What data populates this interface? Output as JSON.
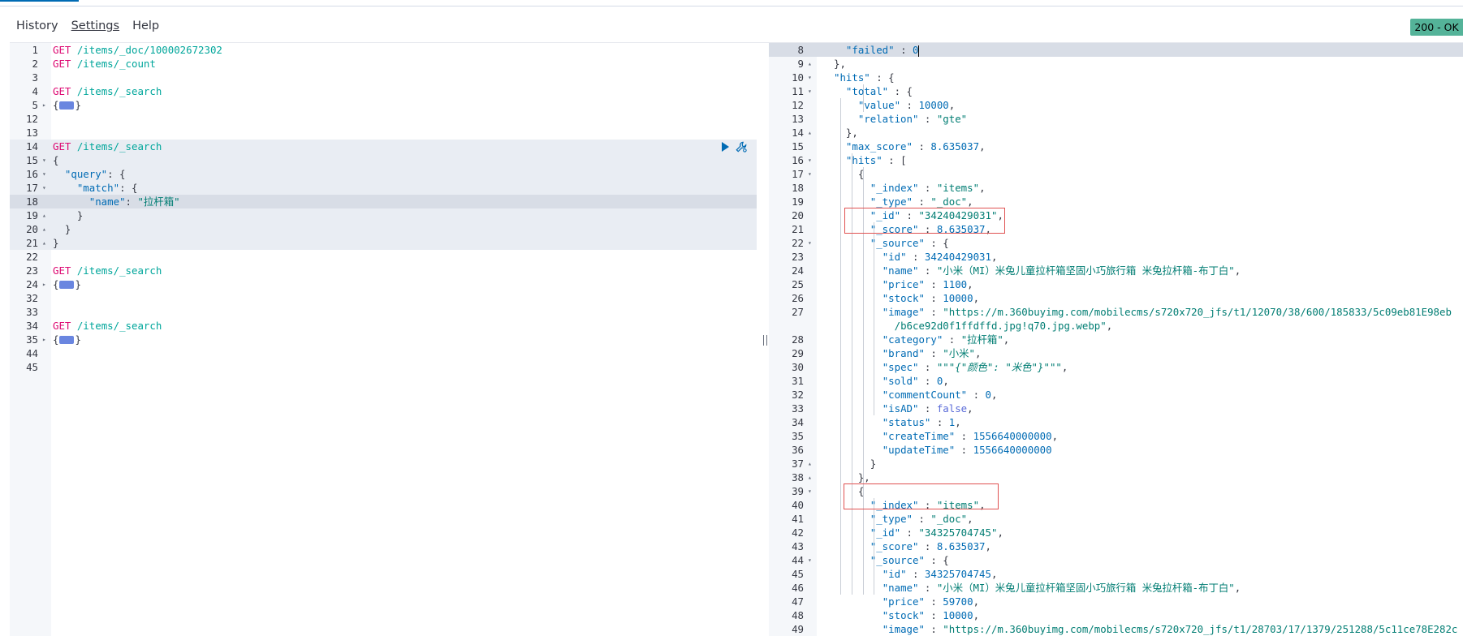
{
  "menu": {
    "history": "History",
    "settings": "Settings",
    "help": "Help"
  },
  "status": {
    "label": "200 - OK",
    "color": "#54b399"
  },
  "icons": {
    "run": "play-icon",
    "settings": "wrench-icon",
    "divider": "resize-handle-icon"
  },
  "request_editor": {
    "lines": [
      {
        "n": "1",
        "fold": "",
        "tokens": [
          [
            "method",
            "GET"
          ],
          [
            "path",
            " /items/_doc/100002672302"
          ]
        ]
      },
      {
        "n": "2",
        "fold": "",
        "tokens": [
          [
            "method",
            "GET"
          ],
          [
            "path",
            " /items/_count"
          ]
        ]
      },
      {
        "n": "3",
        "fold": "",
        "tokens": []
      },
      {
        "n": "4",
        "fold": "",
        "tokens": [
          [
            "method",
            "GET"
          ],
          [
            "path",
            " /items/_search"
          ]
        ]
      },
      {
        "n": "5",
        "fold": "▸",
        "tokens": [
          [
            "p",
            "{"
          ],
          [
            "tag",
            ""
          ],
          [
            "p",
            "}"
          ]
        ]
      },
      {
        "n": "12",
        "fold": "",
        "tokens": []
      },
      {
        "n": "13",
        "fold": "",
        "tokens": []
      },
      {
        "n": "14",
        "fold": "",
        "hl": "block",
        "actions": true,
        "tokens": [
          [
            "method",
            "GET"
          ],
          [
            "path",
            " /items/_search"
          ]
        ]
      },
      {
        "n": "15",
        "fold": "▾",
        "hl": "block",
        "tokens": [
          [
            "p",
            "{"
          ]
        ]
      },
      {
        "n": "16",
        "fold": "▾",
        "hl": "block",
        "tokens": [
          [
            "p",
            "  "
          ],
          [
            "k",
            "\"query\""
          ],
          [
            "p",
            ": {"
          ]
        ]
      },
      {
        "n": "17",
        "fold": "▾",
        "hl": "block",
        "tokens": [
          [
            "p",
            "    "
          ],
          [
            "k",
            "\"match\""
          ],
          [
            "p",
            ": {"
          ]
        ]
      },
      {
        "n": "18",
        "fold": "",
        "hl": "line",
        "tokens": [
          [
            "p",
            "      "
          ],
          [
            "k",
            "\"name\""
          ],
          [
            "p",
            ": "
          ],
          [
            "s",
            "\"拉杆箱\""
          ]
        ]
      },
      {
        "n": "19",
        "fold": "▴",
        "hl": "block",
        "tokens": [
          [
            "p",
            "    }"
          ]
        ]
      },
      {
        "n": "20",
        "fold": "▴",
        "hl": "block",
        "tokens": [
          [
            "p",
            "  }"
          ]
        ]
      },
      {
        "n": "21",
        "fold": "▴",
        "hl": "block",
        "tokens": [
          [
            "p",
            "}"
          ]
        ]
      },
      {
        "n": "22",
        "fold": "",
        "tokens": []
      },
      {
        "n": "23",
        "fold": "",
        "tokens": [
          [
            "method",
            "GET"
          ],
          [
            "path",
            " /items/_search"
          ]
        ]
      },
      {
        "n": "24",
        "fold": "▸",
        "tokens": [
          [
            "p",
            "{"
          ],
          [
            "tag",
            ""
          ],
          [
            "p",
            "}"
          ]
        ]
      },
      {
        "n": "32",
        "fold": "",
        "tokens": []
      },
      {
        "n": "33",
        "fold": "",
        "tokens": []
      },
      {
        "n": "34",
        "fold": "",
        "tokens": [
          [
            "method",
            "GET"
          ],
          [
            "path",
            " /items/_search"
          ]
        ]
      },
      {
        "n": "35",
        "fold": "▸",
        "tokens": [
          [
            "p",
            "{"
          ],
          [
            "tag",
            ""
          ],
          [
            "p",
            "}"
          ]
        ]
      },
      {
        "n": "44",
        "fold": "",
        "tokens": []
      },
      {
        "n": "45",
        "fold": "",
        "tokens": []
      }
    ]
  },
  "response_editor": {
    "lines": [
      {
        "n": "8",
        "fold": "",
        "hl": "line",
        "cursor": true,
        "tokens": [
          [
            "p",
            "  "
          ],
          [
            "k",
            "\"failed\""
          ],
          [
            "p",
            " : "
          ],
          [
            "n",
            "0"
          ]
        ]
      },
      {
        "n": "9",
        "fold": "▴",
        "tokens": [
          [
            "p",
            "},"
          ]
        ]
      },
      {
        "n": "10",
        "fold": "▾",
        "tokens": [
          [
            "k",
            "\"hits\""
          ],
          [
            "p",
            " : {"
          ]
        ]
      },
      {
        "n": "11",
        "fold": "▾",
        "tokens": [
          [
            "p",
            "  "
          ],
          [
            "k",
            "\"total\""
          ],
          [
            "p",
            " : {"
          ]
        ]
      },
      {
        "n": "12",
        "fold": "",
        "tokens": [
          [
            "p",
            "    "
          ],
          [
            "k",
            "\"value\""
          ],
          [
            "p",
            " : "
          ],
          [
            "n",
            "10000"
          ],
          [
            "p",
            ","
          ]
        ]
      },
      {
        "n": "13",
        "fold": "",
        "tokens": [
          [
            "p",
            "    "
          ],
          [
            "k",
            "\"relation\""
          ],
          [
            "p",
            " : "
          ],
          [
            "s",
            "\"gte\""
          ]
        ]
      },
      {
        "n": "14",
        "fold": "▴",
        "tokens": [
          [
            "p",
            "  },"
          ]
        ]
      },
      {
        "n": "15",
        "fold": "",
        "tokens": [
          [
            "p",
            "  "
          ],
          [
            "k",
            "\"max_score\""
          ],
          [
            "p",
            " : "
          ],
          [
            "n",
            "8.635037"
          ],
          [
            "p",
            ","
          ]
        ]
      },
      {
        "n": "16",
        "fold": "▾",
        "tokens": [
          [
            "p",
            "  "
          ],
          [
            "k",
            "\"hits\""
          ],
          [
            "p",
            " : ["
          ]
        ]
      },
      {
        "n": "17",
        "fold": "▾",
        "tokens": [
          [
            "p",
            "    {"
          ]
        ]
      },
      {
        "n": "18",
        "fold": "",
        "tokens": [
          [
            "p",
            "      "
          ],
          [
            "k",
            "\"_index\""
          ],
          [
            "p",
            " : "
          ],
          [
            "s",
            "\"items\""
          ],
          [
            "p",
            ","
          ]
        ]
      },
      {
        "n": "19",
        "fold": "",
        "tokens": [
          [
            "p",
            "      "
          ],
          [
            "k",
            "\"_type\""
          ],
          [
            "p",
            " : "
          ],
          [
            "s",
            "\"_doc\""
          ],
          [
            "p",
            ","
          ]
        ]
      },
      {
        "n": "20",
        "fold": "",
        "tokens": [
          [
            "p",
            "      "
          ],
          [
            "k",
            "\"_id\""
          ],
          [
            "p",
            " : "
          ],
          [
            "s",
            "\"34240429031\""
          ],
          [
            "p",
            ","
          ]
        ]
      },
      {
        "n": "21",
        "fold": "",
        "tokens": [
          [
            "p",
            "      "
          ],
          [
            "k",
            "\"_score\""
          ],
          [
            "p",
            " : "
          ],
          [
            "n",
            "8.635037"
          ],
          [
            "p",
            ","
          ]
        ]
      },
      {
        "n": "22",
        "fold": "▾",
        "tokens": [
          [
            "p",
            "      "
          ],
          [
            "k",
            "\"_source\""
          ],
          [
            "p",
            " : {"
          ]
        ]
      },
      {
        "n": "23",
        "fold": "",
        "tokens": [
          [
            "p",
            "        "
          ],
          [
            "k",
            "\"id\""
          ],
          [
            "p",
            " : "
          ],
          [
            "n",
            "34240429031"
          ],
          [
            "p",
            ","
          ]
        ]
      },
      {
        "n": "24",
        "fold": "",
        "tokens": [
          [
            "p",
            "        "
          ],
          [
            "k",
            "\"name\""
          ],
          [
            "p",
            " : "
          ],
          [
            "s",
            "\"小米（MI）米兔儿童拉杆箱坚固小巧旅行箱 米兔拉杆箱-布丁白\""
          ],
          [
            "p",
            ","
          ]
        ]
      },
      {
        "n": "25",
        "fold": "",
        "tokens": [
          [
            "p",
            "        "
          ],
          [
            "k",
            "\"price\""
          ],
          [
            "p",
            " : "
          ],
          [
            "n",
            "1100"
          ],
          [
            "p",
            ","
          ]
        ]
      },
      {
        "n": "26",
        "fold": "",
        "tokens": [
          [
            "p",
            "        "
          ],
          [
            "k",
            "\"stock\""
          ],
          [
            "p",
            " : "
          ],
          [
            "n",
            "10000"
          ],
          [
            "p",
            ","
          ]
        ]
      },
      {
        "n": "27",
        "fold": "",
        "tokens": [
          [
            "p",
            "        "
          ],
          [
            "k",
            "\"image\""
          ],
          [
            "p",
            " : "
          ],
          [
            "s",
            "\"https://m.360buyimg.com/mobilecms/s720x720_jfs/t1/12070/38/600/185833/5c09eb81E98eb"
          ]
        ]
      },
      {
        "n": "",
        "fold": "",
        "tokens": [
          [
            "p",
            "          "
          ],
          [
            "s",
            "/b6ce92d0f1ffdffd.jpg!q70.jpg.webp\""
          ],
          [
            "p",
            ","
          ]
        ]
      },
      {
        "n": "28",
        "fold": "",
        "tokens": [
          [
            "p",
            "        "
          ],
          [
            "k",
            "\"category\""
          ],
          [
            "p",
            " : "
          ],
          [
            "s",
            "\"拉杆箱\""
          ],
          [
            "p",
            ","
          ]
        ]
      },
      {
        "n": "29",
        "fold": "",
        "tokens": [
          [
            "p",
            "        "
          ],
          [
            "k",
            "\"brand\""
          ],
          [
            "p",
            " : "
          ],
          [
            "s",
            "\"小米\""
          ],
          [
            "p",
            ","
          ]
        ]
      },
      {
        "n": "30",
        "fold": "",
        "tokens": [
          [
            "p",
            "        "
          ],
          [
            "k",
            "\"spec\""
          ],
          [
            "p",
            " : "
          ],
          [
            "s",
            "\"\"\""
          ],
          [
            "i",
            "{\"颜色\": \"米色\"}"
          ],
          [
            "s",
            "\"\"\""
          ],
          [
            "p",
            ","
          ]
        ]
      },
      {
        "n": "31",
        "fold": "",
        "tokens": [
          [
            "p",
            "        "
          ],
          [
            "k",
            "\"sold\""
          ],
          [
            "p",
            " : "
          ],
          [
            "n",
            "0"
          ],
          [
            "p",
            ","
          ]
        ]
      },
      {
        "n": "32",
        "fold": "",
        "tokens": [
          [
            "p",
            "        "
          ],
          [
            "k",
            "\"commentCount\""
          ],
          [
            "p",
            " : "
          ],
          [
            "n",
            "0"
          ],
          [
            "p",
            ","
          ]
        ]
      },
      {
        "n": "33",
        "fold": "",
        "tokens": [
          [
            "p",
            "        "
          ],
          [
            "k",
            "\"isAD\""
          ],
          [
            "p",
            " : "
          ],
          [
            "b",
            "false"
          ],
          [
            "p",
            ","
          ]
        ]
      },
      {
        "n": "34",
        "fold": "",
        "tokens": [
          [
            "p",
            "        "
          ],
          [
            "k",
            "\"status\""
          ],
          [
            "p",
            " : "
          ],
          [
            "n",
            "1"
          ],
          [
            "p",
            ","
          ]
        ]
      },
      {
        "n": "35",
        "fold": "",
        "tokens": [
          [
            "p",
            "        "
          ],
          [
            "k",
            "\"createTime\""
          ],
          [
            "p",
            " : "
          ],
          [
            "n",
            "1556640000000"
          ],
          [
            "p",
            ","
          ]
        ]
      },
      {
        "n": "36",
        "fold": "",
        "tokens": [
          [
            "p",
            "        "
          ],
          [
            "k",
            "\"updateTime\""
          ],
          [
            "p",
            " : "
          ],
          [
            "n",
            "1556640000000"
          ]
        ]
      },
      {
        "n": "37",
        "fold": "▴",
        "tokens": [
          [
            "p",
            "      }"
          ]
        ]
      },
      {
        "n": "38",
        "fold": "▴",
        "tokens": [
          [
            "p",
            "    },"
          ]
        ]
      },
      {
        "n": "39",
        "fold": "▾",
        "tokens": [
          [
            "p",
            "    {"
          ]
        ]
      },
      {
        "n": "40",
        "fold": "",
        "tokens": [
          [
            "p",
            "      "
          ],
          [
            "k",
            "\"_index\""
          ],
          [
            "p",
            " : "
          ],
          [
            "s",
            "\"items\""
          ],
          [
            "p",
            ","
          ]
        ]
      },
      {
        "n": "41",
        "fold": "",
        "tokens": [
          [
            "p",
            "      "
          ],
          [
            "k",
            "\"_type\""
          ],
          [
            "p",
            " : "
          ],
          [
            "s",
            "\"_doc\""
          ],
          [
            "p",
            ","
          ]
        ]
      },
      {
        "n": "42",
        "fold": "",
        "tokens": [
          [
            "p",
            "      "
          ],
          [
            "k",
            "\"_id\""
          ],
          [
            "p",
            " : "
          ],
          [
            "s",
            "\"34325704745\""
          ],
          [
            "p",
            ","
          ]
        ]
      },
      {
        "n": "43",
        "fold": "",
        "tokens": [
          [
            "p",
            "      "
          ],
          [
            "k",
            "\"_score\""
          ],
          [
            "p",
            " : "
          ],
          [
            "n",
            "8.635037"
          ],
          [
            "p",
            ","
          ]
        ]
      },
      {
        "n": "44",
        "fold": "▾",
        "tokens": [
          [
            "p",
            "      "
          ],
          [
            "k",
            "\"_source\""
          ],
          [
            "p",
            " : {"
          ]
        ]
      },
      {
        "n": "45",
        "fold": "",
        "tokens": [
          [
            "p",
            "        "
          ],
          [
            "k",
            "\"id\""
          ],
          [
            "p",
            " : "
          ],
          [
            "n",
            "34325704745"
          ],
          [
            "p",
            ","
          ]
        ]
      },
      {
        "n": "46",
        "fold": "",
        "tokens": [
          [
            "p",
            "        "
          ],
          [
            "k",
            "\"name\""
          ],
          [
            "p",
            " : "
          ],
          [
            "s",
            "\"小米（MI）米兔儿童拉杆箱坚固小巧旅行箱 米兔拉杆箱-布丁白\""
          ],
          [
            "p",
            ","
          ]
        ]
      },
      {
        "n": "47",
        "fold": "",
        "tokens": [
          [
            "p",
            "        "
          ],
          [
            "k",
            "\"price\""
          ],
          [
            "p",
            " : "
          ],
          [
            "n",
            "59700"
          ],
          [
            "p",
            ","
          ]
        ]
      },
      {
        "n": "48",
        "fold": "",
        "tokens": [
          [
            "p",
            "        "
          ],
          [
            "k",
            "\"stock\""
          ],
          [
            "p",
            " : "
          ],
          [
            "n",
            "10000"
          ],
          [
            "p",
            ","
          ]
        ]
      },
      {
        "n": "49",
        "fold": "",
        "tokens": [
          [
            "p",
            "        "
          ],
          [
            "k",
            "\"image\""
          ],
          [
            "p",
            " : "
          ],
          [
            "s",
            "\"https://m.360buyimg.com/mobilecms/s720x720_jfs/t1/28703/17/1379/251288/5c11ce78E282c"
          ]
        ]
      }
    ]
  }
}
